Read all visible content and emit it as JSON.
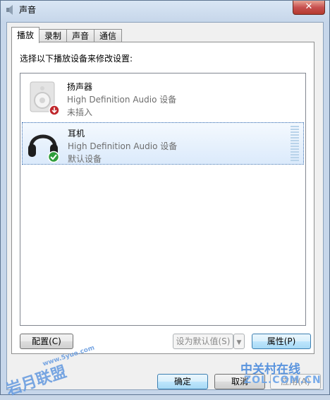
{
  "window": {
    "title": "声音",
    "close_glyph": "✕"
  },
  "tabs": [
    {
      "label": "播放",
      "active": true
    },
    {
      "label": "录制"
    },
    {
      "label": "声音"
    },
    {
      "label": "通信"
    }
  ],
  "instruction": "选择以下播放设备来修改设置:",
  "devices": [
    {
      "name": "扬声器",
      "description": "High Definition Audio 设备",
      "status": "未插入",
      "icon": "speaker-icon",
      "badge": "unplugged-badge-icon"
    },
    {
      "name": "耳机",
      "description": "High Definition Audio 设备",
      "status": "默认设备",
      "icon": "headphones-icon",
      "badge": "default-checkmark-icon",
      "selected": true
    }
  ],
  "panel_buttons": {
    "configure": "配置(C)",
    "set_default": "设为默认值(S)",
    "properties": "属性(P)"
  },
  "dialog_buttons": {
    "ok": "确定",
    "cancel": "取消",
    "apply": "应用(A)"
  },
  "watermarks": {
    "left_text": "岩月联盟",
    "left_url": "www.5yue.com",
    "right_text": "中关村在线",
    "right_url": "ZOL.COM.CN"
  },
  "colors": {
    "selection": "#dbeafb",
    "accent": "#3c7fb1",
    "close": "#c75050"
  }
}
